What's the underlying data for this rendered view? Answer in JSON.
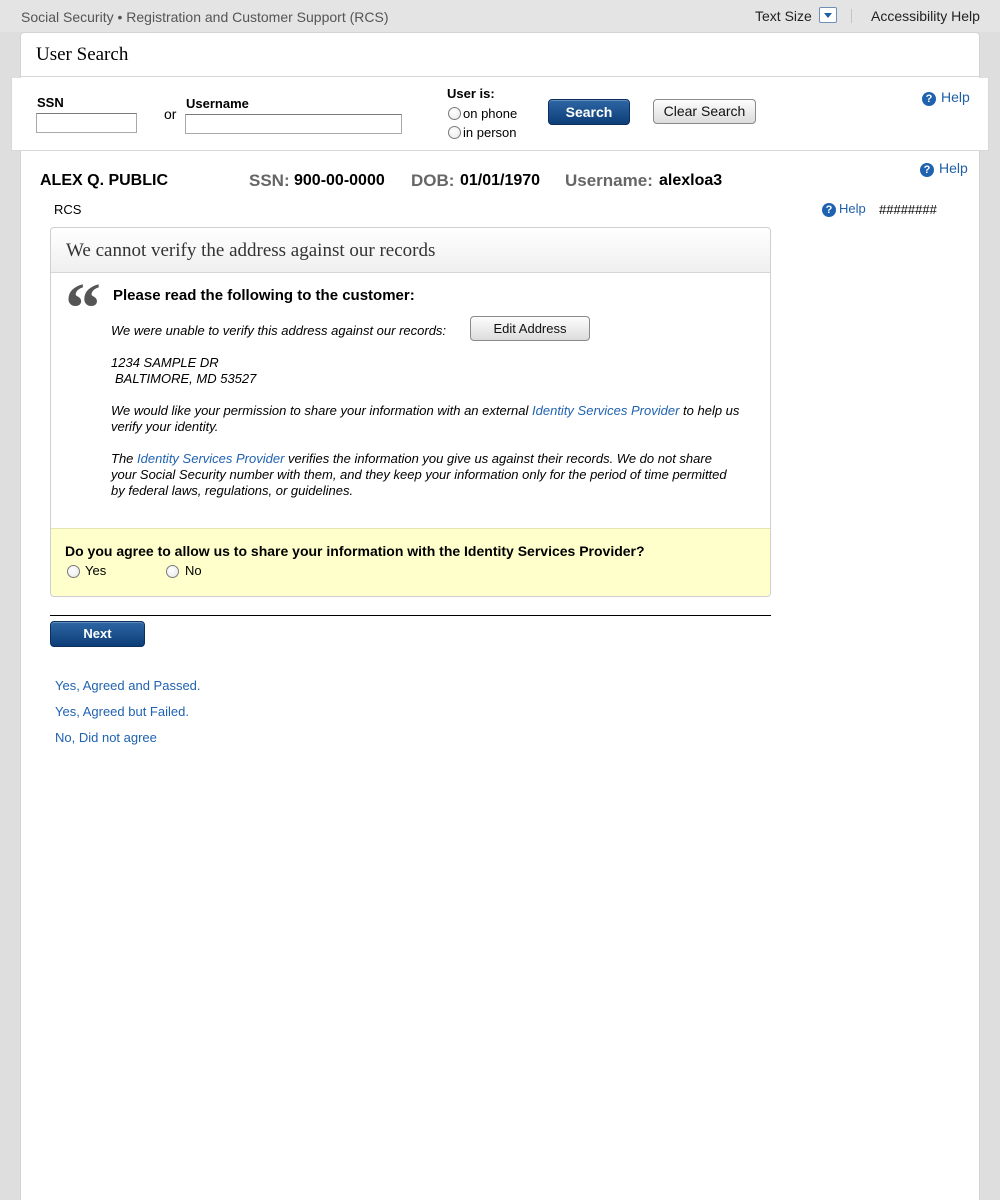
{
  "topbar": {
    "app_title": "Social Security • Registration and Customer Support (RCS)",
    "text_size_label": "Text Size",
    "accessibility_help": "Accessibility Help"
  },
  "page": {
    "title": "User Search"
  },
  "search": {
    "ssn_label": "SSN",
    "ssn_value": "",
    "or_label": "or",
    "username_label": "Username",
    "username_value": "",
    "user_is_label": "User is:",
    "options": [
      "on phone",
      "in person"
    ],
    "search_button": "Search",
    "clear_button": "Clear Search",
    "help_label": "Help"
  },
  "customer": {
    "name": "ALEX Q. PUBLIC",
    "ssn_label": "SSN:",
    "ssn": "900-00-0000",
    "dob_label": "DOB:",
    "dob": "01/01/1970",
    "username_label": "Username:",
    "username": "alexloa3",
    "help_label": "Help",
    "section": "RCS",
    "section_help": "Help",
    "hash": "########"
  },
  "address_panel": {
    "title": "We cannot verify the address against our records",
    "read_heading": "Please read the following to the customer:",
    "unable_text": "We were unable to verify this address against our records:",
    "edit_button": "Edit Address",
    "address_line1": "1234 SAMPLE DR",
    "address_line2": "BALTIMORE, MD 53527",
    "permission_pre": "We would like your permission to share your information with an external ",
    "permission_link": "Identity Services Provider",
    "permission_post": " to help us verify your identity.",
    "provider_pre": "The ",
    "provider_link": "Identity Services Provider",
    "provider_post": " verifies the information you give us against their records. We do not share your Social Security number with them, and they keep your information only for the period of time permitted by federal laws, regulations, or guidelines.",
    "agree_question": "Do you agree to allow us to share your information with the Identity Services Provider?",
    "yes_label": "Yes",
    "no_label": "No"
  },
  "actions": {
    "next_button": "Next",
    "links": [
      "Yes, Agreed and Passed.",
      "Yes, Agreed but Failed.",
      "No, Did not agree"
    ]
  },
  "colors": {
    "link": "#1f62b0",
    "primary_button": "#0d3e78",
    "agree_bg": "#ffffcc"
  }
}
